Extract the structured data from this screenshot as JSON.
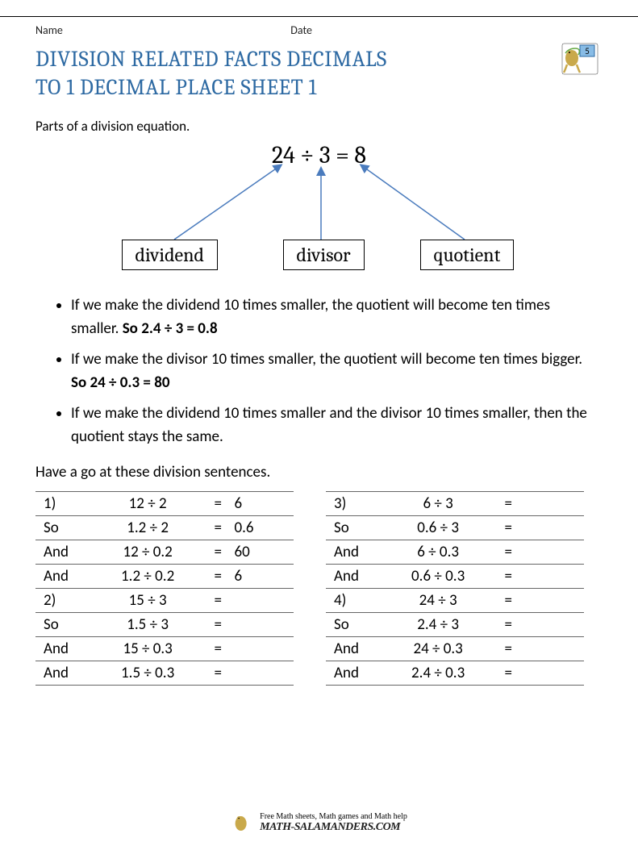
{
  "header": {
    "name_label": "Name",
    "date_label": "Date",
    "grade_badge": "5"
  },
  "title_line1": "DIVISION RELATED FACTS DECIMALS",
  "title_line2": "TO 1 DECIMAL PLACE SHEET 1",
  "intro": "Parts of a division equation.",
  "diagram": {
    "equation": "24 ÷ 3 = 8",
    "label_dividend": "dividend",
    "label_divisor": "divisor",
    "label_quotient": "quotient"
  },
  "bullets": [
    {
      "text": "If we make the dividend 10 times smaller, the quotient will become ten times smaller. ",
      "bold": "So 2.4 ÷ 3 = 0.8"
    },
    {
      "text": "If we make the divisor 10 times smaller, the quotient will become ten times bigger. ",
      "bold": "So 24 ÷ 0.3 = 80"
    },
    {
      "text": "If we make the dividend 10 times smaller and the divisor 10 times smaller, then the quotient stays the same.",
      "bold": ""
    }
  ],
  "have_go": "Have a go at these division sentences.",
  "tables": {
    "left": [
      {
        "lab": "1)",
        "expr": "12 ÷ 2",
        "eq": "=",
        "ans": "6"
      },
      {
        "lab": "So",
        "expr": "1.2 ÷ 2",
        "eq": "=",
        "ans": "0.6"
      },
      {
        "lab": "And",
        "expr": "12 ÷ 0.2",
        "eq": "=",
        "ans": "60"
      },
      {
        "lab": "And",
        "expr": "1.2 ÷ 0.2",
        "eq": "=",
        "ans": "6"
      },
      {
        "lab": "2)",
        "expr": "15 ÷ 3",
        "eq": "=",
        "ans": ""
      },
      {
        "lab": "So",
        "expr": "1.5 ÷ 3",
        "eq": "=",
        "ans": ""
      },
      {
        "lab": "And",
        "expr": "15 ÷ 0.3",
        "eq": "=",
        "ans": ""
      },
      {
        "lab": "And",
        "expr": "1.5 ÷ 0.3",
        "eq": "=",
        "ans": ""
      }
    ],
    "right": [
      {
        "lab": "3)",
        "expr": "6 ÷ 3",
        "eq": "=",
        "ans": ""
      },
      {
        "lab": "So",
        "expr": "0.6 ÷ 3",
        "eq": "=",
        "ans": ""
      },
      {
        "lab": "And",
        "expr": "6 ÷ 0.3",
        "eq": "=",
        "ans": ""
      },
      {
        "lab": "And",
        "expr": "0.6 ÷ 0.3",
        "eq": "=",
        "ans": ""
      },
      {
        "lab": "4)",
        "expr": "24 ÷ 3",
        "eq": "=",
        "ans": ""
      },
      {
        "lab": "So",
        "expr": "2.4 ÷ 3",
        "eq": "=",
        "ans": ""
      },
      {
        "lab": "And",
        "expr": "24 ÷ 0.3",
        "eq": "=",
        "ans": ""
      },
      {
        "lab": "And",
        "expr": "2.4 ÷ 0.3",
        "eq": "=",
        "ans": ""
      }
    ]
  },
  "footer": {
    "tagline": "Free Math sheets, Math games and Math help",
    "site": "MATH-SALAMANDERS.COM"
  }
}
